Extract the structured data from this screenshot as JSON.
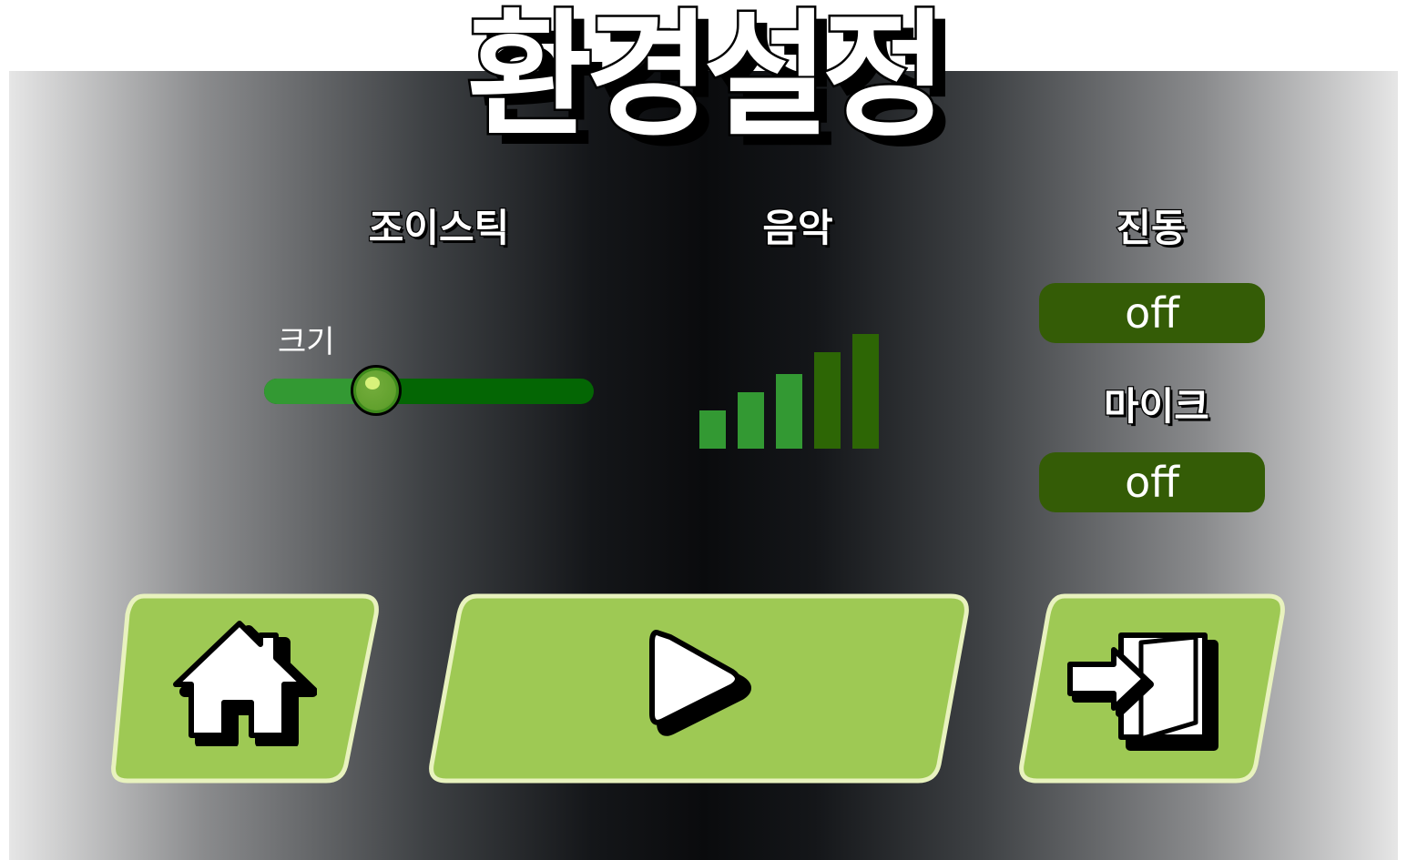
{
  "title": "환경설정",
  "joystick": {
    "label": "조이스틱",
    "size_label": "크기",
    "size_value": 0.34
  },
  "music": {
    "label": "음악",
    "volume_level": 3,
    "volume_max": 5
  },
  "vibration": {
    "label": "진동",
    "state": "off"
  },
  "mic": {
    "label": "마이크",
    "state": "off"
  },
  "buttons": {
    "home_icon": "home-icon",
    "play_icon": "play-icon",
    "exit_icon": "exit-door-icon"
  },
  "colors": {
    "button_green": "#9ec954",
    "button_border": "#e8f2be",
    "toggle_green": "#345c06",
    "bar_active": "#339933",
    "bar_inactive": "#2d6605",
    "slider_fill": "#339933",
    "slider_track": "#046604"
  }
}
